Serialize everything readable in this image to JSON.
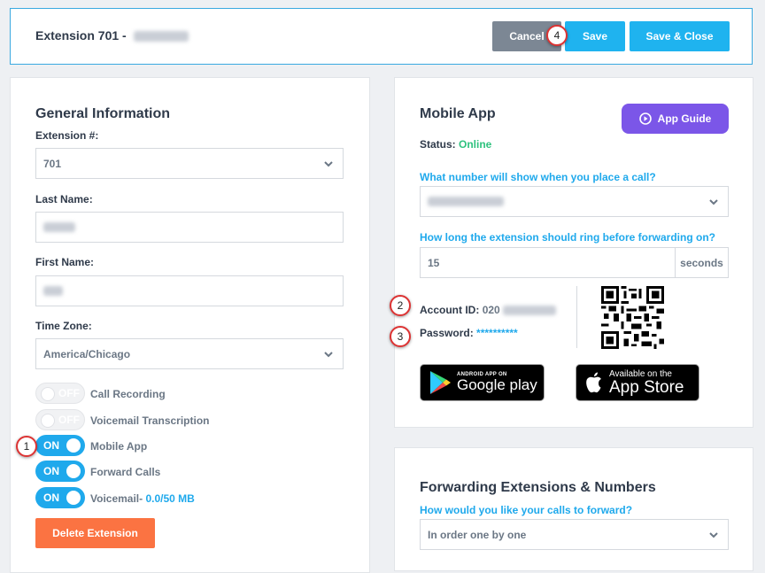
{
  "header": {
    "title": "Extension 701 -",
    "cancel_label": "Cancel",
    "save_label": "Save",
    "save_close_label": "Save & Close"
  },
  "general": {
    "title": "General Information",
    "extension_label": "Extension #:",
    "extension_value": "701",
    "last_name_label": "Last Name:",
    "first_name_label": "First Name:",
    "time_zone_label": "Time Zone:",
    "time_zone_value": "America/Chicago",
    "toggles": [
      {
        "state": "OFF",
        "label": "Call Recording"
      },
      {
        "state": "OFF",
        "label": "Voicemail Transcription"
      },
      {
        "state": "ON",
        "label": "Mobile App"
      },
      {
        "state": "ON",
        "label": "Forward Calls"
      },
      {
        "state": "ON",
        "label": "Voicemail-"
      }
    ],
    "voicemail_usage": "0.0/50 MB",
    "delete_label": "Delete Extension"
  },
  "mobile": {
    "title": "Mobile App",
    "guide_label": "App Guide",
    "status_label": "Status:",
    "status_value": "Online",
    "caller_question": "What number will show when you place a call?",
    "ring_question": "How long the extension should ring before forwarding on?",
    "ring_value": "15",
    "ring_unit": "seconds",
    "account_label": "Account ID:",
    "account_value": "020",
    "password_label": "Password:",
    "password_value": "**********",
    "google_small": "ANDROID APP ON",
    "google_big": "Google play",
    "apple_small": "Available on the",
    "apple_big": "App Store"
  },
  "forwarding": {
    "title": "Forwarding Extensions & Numbers",
    "question": "How would you like your calls to forward?",
    "value": "In order one by one"
  },
  "callouts": [
    "1",
    "2",
    "3",
    "4"
  ],
  "colors": {
    "accent": "#1fb3ef",
    "cancel": "#7c8794",
    "delete": "#fb7342",
    "guide": "#7b56e8",
    "online": "#2ec27e"
  }
}
